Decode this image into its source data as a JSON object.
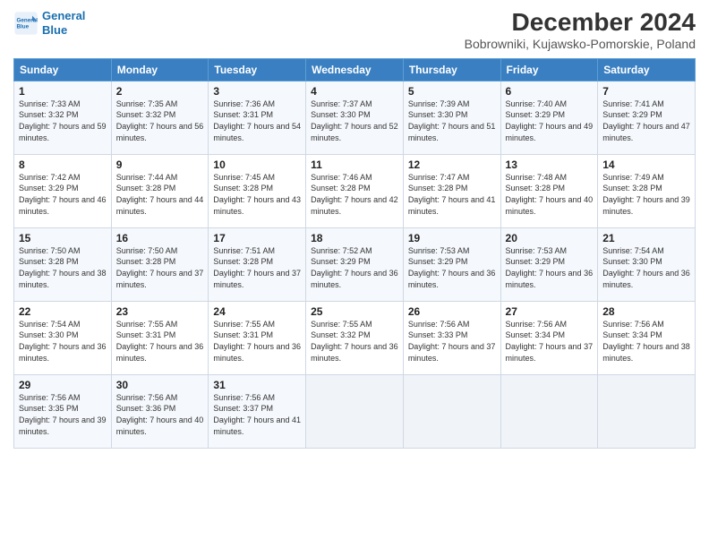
{
  "logo": {
    "line1": "General",
    "line2": "Blue"
  },
  "title": "December 2024",
  "subtitle": "Bobrowniki, Kujawsko-Pomorskie, Poland",
  "days_of_week": [
    "Sunday",
    "Monday",
    "Tuesday",
    "Wednesday",
    "Thursday",
    "Friday",
    "Saturday"
  ],
  "weeks": [
    [
      {
        "day": "1",
        "sunrise": "7:33 AM",
        "sunset": "3:32 PM",
        "daylight": "7 hours and 59 minutes."
      },
      {
        "day": "2",
        "sunrise": "7:35 AM",
        "sunset": "3:32 PM",
        "daylight": "7 hours and 56 minutes."
      },
      {
        "day": "3",
        "sunrise": "7:36 AM",
        "sunset": "3:31 PM",
        "daylight": "7 hours and 54 minutes."
      },
      {
        "day": "4",
        "sunrise": "7:37 AM",
        "sunset": "3:30 PM",
        "daylight": "7 hours and 52 minutes."
      },
      {
        "day": "5",
        "sunrise": "7:39 AM",
        "sunset": "3:30 PM",
        "daylight": "7 hours and 51 minutes."
      },
      {
        "day": "6",
        "sunrise": "7:40 AM",
        "sunset": "3:29 PM",
        "daylight": "7 hours and 49 minutes."
      },
      {
        "day": "7",
        "sunrise": "7:41 AM",
        "sunset": "3:29 PM",
        "daylight": "7 hours and 47 minutes."
      }
    ],
    [
      {
        "day": "8",
        "sunrise": "7:42 AM",
        "sunset": "3:29 PM",
        "daylight": "7 hours and 46 minutes."
      },
      {
        "day": "9",
        "sunrise": "7:44 AM",
        "sunset": "3:28 PM",
        "daylight": "7 hours and 44 minutes."
      },
      {
        "day": "10",
        "sunrise": "7:45 AM",
        "sunset": "3:28 PM",
        "daylight": "7 hours and 43 minutes."
      },
      {
        "day": "11",
        "sunrise": "7:46 AM",
        "sunset": "3:28 PM",
        "daylight": "7 hours and 42 minutes."
      },
      {
        "day": "12",
        "sunrise": "7:47 AM",
        "sunset": "3:28 PM",
        "daylight": "7 hours and 41 minutes."
      },
      {
        "day": "13",
        "sunrise": "7:48 AM",
        "sunset": "3:28 PM",
        "daylight": "7 hours and 40 minutes."
      },
      {
        "day": "14",
        "sunrise": "7:49 AM",
        "sunset": "3:28 PM",
        "daylight": "7 hours and 39 minutes."
      }
    ],
    [
      {
        "day": "15",
        "sunrise": "7:50 AM",
        "sunset": "3:28 PM",
        "daylight": "7 hours and 38 minutes."
      },
      {
        "day": "16",
        "sunrise": "7:50 AM",
        "sunset": "3:28 PM",
        "daylight": "7 hours and 37 minutes."
      },
      {
        "day": "17",
        "sunrise": "7:51 AM",
        "sunset": "3:28 PM",
        "daylight": "7 hours and 37 minutes."
      },
      {
        "day": "18",
        "sunrise": "7:52 AM",
        "sunset": "3:29 PM",
        "daylight": "7 hours and 36 minutes."
      },
      {
        "day": "19",
        "sunrise": "7:53 AM",
        "sunset": "3:29 PM",
        "daylight": "7 hours and 36 minutes."
      },
      {
        "day": "20",
        "sunrise": "7:53 AM",
        "sunset": "3:29 PM",
        "daylight": "7 hours and 36 minutes."
      },
      {
        "day": "21",
        "sunrise": "7:54 AM",
        "sunset": "3:30 PM",
        "daylight": "7 hours and 36 minutes."
      }
    ],
    [
      {
        "day": "22",
        "sunrise": "7:54 AM",
        "sunset": "3:30 PM",
        "daylight": "7 hours and 36 minutes."
      },
      {
        "day": "23",
        "sunrise": "7:55 AM",
        "sunset": "3:31 PM",
        "daylight": "7 hours and 36 minutes."
      },
      {
        "day": "24",
        "sunrise": "7:55 AM",
        "sunset": "3:31 PM",
        "daylight": "7 hours and 36 minutes."
      },
      {
        "day": "25",
        "sunrise": "7:55 AM",
        "sunset": "3:32 PM",
        "daylight": "7 hours and 36 minutes."
      },
      {
        "day": "26",
        "sunrise": "7:56 AM",
        "sunset": "3:33 PM",
        "daylight": "7 hours and 37 minutes."
      },
      {
        "day": "27",
        "sunrise": "7:56 AM",
        "sunset": "3:34 PM",
        "daylight": "7 hours and 37 minutes."
      },
      {
        "day": "28",
        "sunrise": "7:56 AM",
        "sunset": "3:34 PM",
        "daylight": "7 hours and 38 minutes."
      }
    ],
    [
      {
        "day": "29",
        "sunrise": "7:56 AM",
        "sunset": "3:35 PM",
        "daylight": "7 hours and 39 minutes."
      },
      {
        "day": "30",
        "sunrise": "7:56 AM",
        "sunset": "3:36 PM",
        "daylight": "7 hours and 40 minutes."
      },
      {
        "day": "31",
        "sunrise": "7:56 AM",
        "sunset": "3:37 PM",
        "daylight": "7 hours and 41 minutes."
      },
      null,
      null,
      null,
      null
    ]
  ],
  "labels": {
    "sunrise": "Sunrise:",
    "sunset": "Sunset:",
    "daylight": "Daylight:"
  }
}
